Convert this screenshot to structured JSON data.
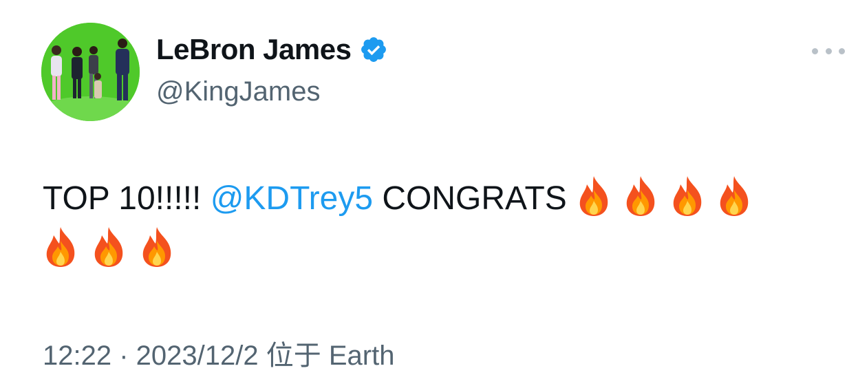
{
  "author": {
    "display_name": "LeBron James",
    "handle": "@KingJames",
    "verified": true,
    "avatar": "group-photo-green-screen"
  },
  "tweet": {
    "text_before": "TOP 10!!!!! ",
    "mention": "@KDTrey5",
    "text_after": " CONGRATS",
    "emoji": "fire",
    "emoji_count_line1": 4,
    "emoji_count_line2": 3
  },
  "meta": {
    "time": "12:22",
    "separator": " · ",
    "date": "2023/12/2",
    "location_prefix": " 位于 ",
    "location": "Earth"
  },
  "colors": {
    "mention": "#1d9bf0",
    "verified": "#1d9bf0",
    "secondary_text": "#536471",
    "avatar_bg": "#4fc92a"
  },
  "icons": {
    "verified": "verified-badge-icon",
    "more": "more-options-icon",
    "emoji": "fire-emoji-icon"
  }
}
